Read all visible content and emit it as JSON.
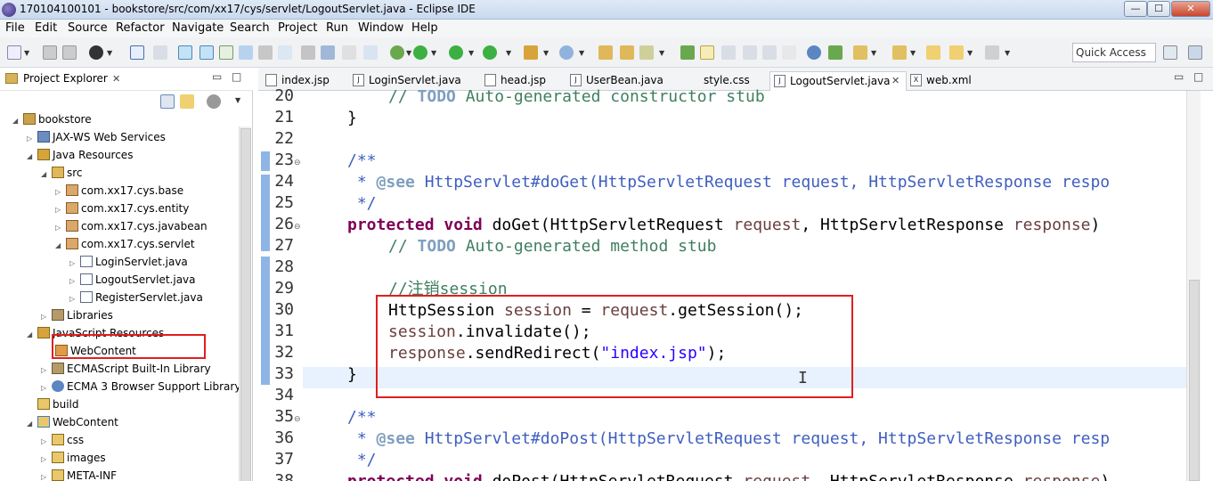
{
  "window": {
    "title": "170104100101 - bookstore/src/com/xx17/cys/servlet/LogoutServlet.java - Eclipse IDE",
    "min_label": "—",
    "max_label": "☐",
    "close_label": "✕"
  },
  "menu": [
    "File",
    "Edit",
    "Source",
    "Refactor",
    "Navigate",
    "Search",
    "Project",
    "Run",
    "Window",
    "Help"
  ],
  "toolbar": {
    "quick_access": "Quick Access"
  },
  "explorer": {
    "title": "Project Explorer",
    "close": "✕",
    "items": [
      {
        "label": "bookstore",
        "icon": "project-icon"
      },
      {
        "label": "JAX-WS Web Services",
        "icon": "webservice-icon"
      },
      {
        "label": "Java Resources",
        "icon": "java-resources-icon"
      },
      {
        "label": "src",
        "icon": "source-folder-icon"
      },
      {
        "label": "com.xx17.cys.base",
        "icon": "package-icon"
      },
      {
        "label": "com.xx17.cys.entity",
        "icon": "package-icon"
      },
      {
        "label": "com.xx17.cys.javabean",
        "icon": "package-icon"
      },
      {
        "label": "com.xx17.cys.servlet",
        "icon": "package-icon"
      },
      {
        "label": "LoginServlet.java",
        "icon": "java-file-icon"
      },
      {
        "label": "LogoutServlet.java",
        "icon": "java-file-icon"
      },
      {
        "label": "RegisterServlet.java",
        "icon": "java-file-icon"
      },
      {
        "label": "Libraries",
        "icon": "libraries-icon"
      },
      {
        "label": "JavaScript Resources",
        "icon": "js-resources-icon"
      },
      {
        "label": "WebContent",
        "icon": "webcontent-icon"
      },
      {
        "label": "ECMAScript Built-In Library",
        "icon": "library-icon"
      },
      {
        "label": "ECMA 3 Browser Support Library",
        "icon": "globe-library-icon"
      },
      {
        "label": "build",
        "icon": "folder-icon"
      },
      {
        "label": "WebContent",
        "icon": "web-folder-icon"
      },
      {
        "label": "css",
        "icon": "folder-icon"
      },
      {
        "label": "images",
        "icon": "folder-icon"
      },
      {
        "label": "META-INF",
        "icon": "folder-icon"
      }
    ]
  },
  "tabs": [
    {
      "label": "index.jsp",
      "icon": "jsp-file-icon"
    },
    {
      "label": "LoginServlet.java",
      "icon": "java-file-icon"
    },
    {
      "label": "head.jsp",
      "icon": "jsp-file-icon"
    },
    {
      "label": "UserBean.java",
      "icon": "java-file-icon"
    },
    {
      "label": "style.css",
      "icon": "css-file-icon"
    },
    {
      "label": "LogoutServlet.java",
      "icon": "java-file-icon",
      "active": true,
      "close": "✕"
    },
    {
      "label": "web.xml",
      "icon": "xml-file-icon"
    }
  ],
  "editor": {
    "line_numbers": [
      "20",
      "21",
      "22",
      "23",
      "24",
      "25",
      "26",
      "27",
      "28",
      "29",
      "30",
      "31",
      "32",
      "33",
      "34",
      "35",
      "36",
      "37",
      "38"
    ],
    "cursor": "I",
    "code": {
      "l20_a": "// ",
      "l20_todo": "TODO",
      "l20_b": " Auto-generated constructor stub",
      "l21": "}",
      "l23": "/**",
      "l24_a": " * ",
      "l24_tag": "@see",
      "l24_b": " HttpServlet#doGet(HttpServletRequest request, HttpServletResponse respo",
      "l25": " */",
      "l26_kw1": "protected",
      "l26_kw2": "void",
      "l26_a": " doGet(HttpServletRequest ",
      "l26_p1": "request",
      "l26_b": ", HttpServletResponse ",
      "l26_p2": "response",
      "l26_c": ")",
      "l27_a": "// ",
      "l27_todo": "TODO",
      "l27_b": " Auto-generated method stub",
      "l29": "//注销session",
      "l30_a": "HttpSession ",
      "l30_v": "session",
      "l30_b": " = ",
      "l30_v2": "request",
      "l30_c": ".getSession();",
      "l31_v": "session",
      "l31_b": ".invalidate();",
      "l32_v": "response",
      "l32_b": ".sendRedirect(",
      "l32_str": "\"index.jsp\"",
      "l32_c": ");",
      "l33": "}",
      "l35": "/**",
      "l36_a": " * ",
      "l36_tag": "@see",
      "l36_b": " HttpServlet#doPost(HttpServletRequest request, HttpServletResponse resp",
      "l37": " */",
      "l38_kw1": "protected",
      "l38_kw2": "void",
      "l38_a": " doPost(HttpServletRequest ",
      "l38_p1": "request",
      "l38_b": ", HttpServletResponse ",
      "l38_p2": "response",
      "l38_c": ")"
    }
  }
}
